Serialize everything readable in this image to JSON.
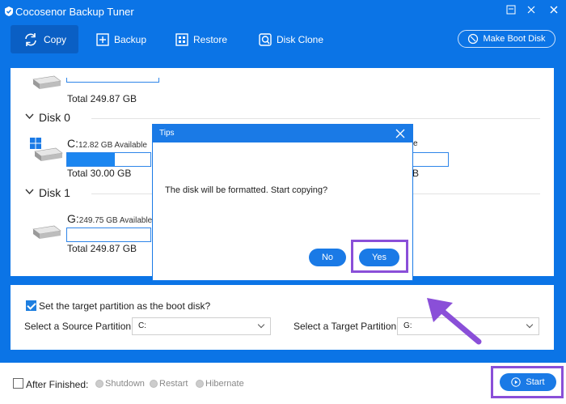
{
  "app": {
    "title": "Cocosenor Backup Tuner",
    "window_controls": [
      "minimize-icon",
      "maximize-icon",
      "close-icon"
    ]
  },
  "toolbar": {
    "items": [
      {
        "label": "Copy",
        "icon": "copy-icon",
        "active": true
      },
      {
        "label": "Backup",
        "icon": "backup-icon",
        "active": false
      },
      {
        "label": "Restore",
        "icon": "restore-icon",
        "active": false
      },
      {
        "label": "Disk Clone",
        "icon": "disk-clone-icon",
        "active": false
      }
    ],
    "boot_button": "Make Boot Disk"
  },
  "disks": {
    "top_partition": {
      "total": "Total 249.87 GB",
      "used_fraction": 0.0
    },
    "disk0": {
      "header": "Disk 0",
      "partition": {
        "letter": "C:",
        "available": "12.82 GB Available",
        "total": "Total 30.00 GB",
        "used_fraction": 0.57
      },
      "right_partition": {
        "available_suffix": "e",
        "total_suffix": "B"
      }
    },
    "disk1": {
      "header": "Disk 1",
      "partition": {
        "letter": "G:",
        "available": "249.75 GB Available",
        "total": "Total 249.87 GB",
        "used_fraction": 0.0
      }
    }
  },
  "settings": {
    "boot_checkbox": {
      "label": "Set the target partition as the boot disk?",
      "checked": true
    },
    "source": {
      "label": "Select a Source Partition:",
      "value": "C:"
    },
    "target": {
      "label": "Select a Target Partition:",
      "value": "G:"
    }
  },
  "footer": {
    "after_finished": {
      "label": "After Finished:",
      "checked": false
    },
    "options": [
      "Shutdown",
      "Restart",
      "Hibernate"
    ],
    "start_label": "Start"
  },
  "dialog": {
    "title": "Tips",
    "message": "The disk will be formatted. Start copying?",
    "no_label": "No",
    "yes_label": "Yes"
  },
  "colors": {
    "primary": "#0b74e6",
    "button": "#1a7ae6",
    "highlight": "#8a4fd8"
  }
}
